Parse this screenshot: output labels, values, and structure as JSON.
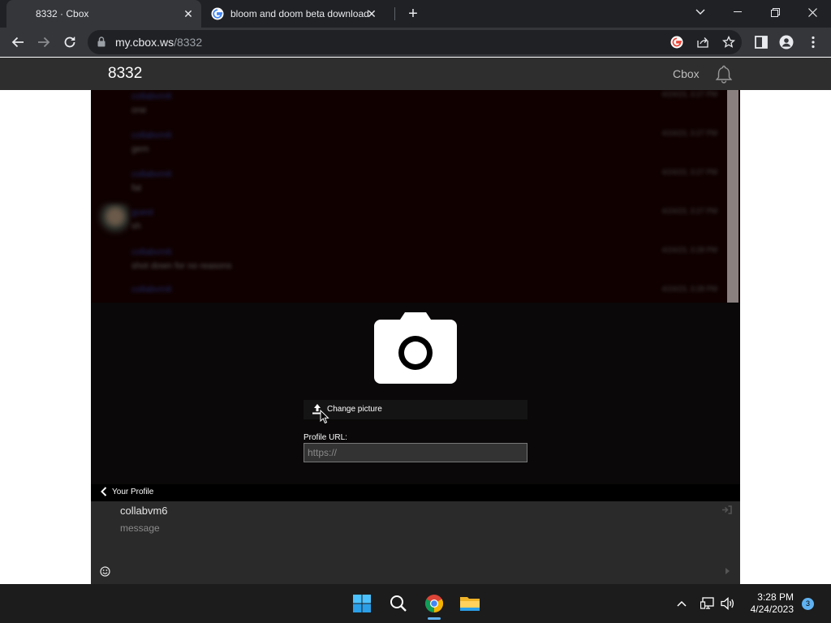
{
  "browser": {
    "tabs": [
      {
        "title": "8332 · Cbox",
        "active": true
      },
      {
        "title": "bloom and doom beta download",
        "active": false
      }
    ],
    "url_host": "my.cbox.ws",
    "url_path": "/8332"
  },
  "header": {
    "box_title": "8332",
    "cbox_link": "Cbox"
  },
  "chat": {
    "messages": [
      {
        "name": "collabvm6",
        "text": "one",
        "time": "4/24/23, 3:27 PM"
      },
      {
        "name": "collabvm6",
        "text": "gem",
        "time": "4/24/23, 3:27 PM"
      },
      {
        "name": "collabvm6",
        "text": "fat",
        "time": "4/24/23, 3:27 PM"
      },
      {
        "name": "guest",
        "text": "sh",
        "time": "4/24/23, 3:27 PM"
      },
      {
        "name": "collabvm6",
        "text": "shot down for no reasons",
        "time": "4/24/23, 3:28 PM"
      },
      {
        "name": "collabvm6",
        "text": "",
        "time": "4/24/23, 3:28 PM"
      }
    ]
  },
  "profile": {
    "change_picture_label": "Change picture",
    "profile_url_label": "Profile URL:",
    "profile_url_placeholder": "https://",
    "back_label": "Your Profile"
  },
  "post": {
    "username": "collabvm6",
    "message_placeholder": "message"
  },
  "taskbar": {
    "time": "3:28 PM",
    "date": "4/24/2023",
    "notification_count": "3"
  },
  "colors": {
    "accent": "#5fb2f2",
    "page_header": "#2e2e2e",
    "chat_background": "#100000"
  }
}
